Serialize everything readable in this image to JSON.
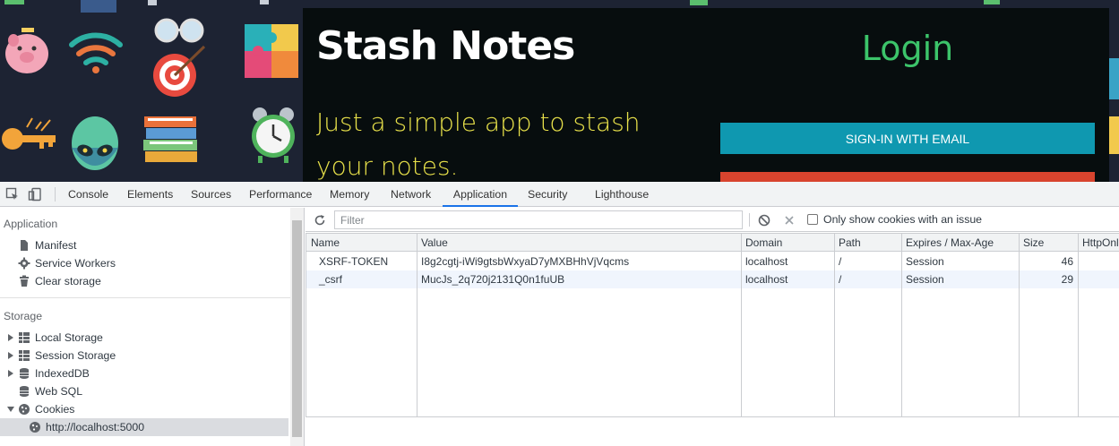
{
  "page": {
    "title": "Stash Notes",
    "tagline": "Just a simple app to stash your notes.",
    "login_heading": "Login",
    "signin_email_label": "SIGN-IN WITH EMAIL",
    "colors": {
      "card": "#070d0e",
      "title": "#ffffff",
      "tagline": "#e8e14a",
      "login": "#3cc46a",
      "email_button": "#0f98b0",
      "google_button": "#d8442e"
    },
    "background_icons": [
      "piggy-bank-icon",
      "wifi-icon",
      "glasses-icon",
      "target-icon",
      "puzzle-icon",
      "key-icon",
      "alien-icon",
      "books-icon",
      "alarm-clock-icon"
    ]
  },
  "devtools": {
    "tabs": [
      "Console",
      "Elements",
      "Sources",
      "Performance",
      "Memory",
      "Network",
      "Application",
      "Security",
      "Lighthouse"
    ],
    "active_tab": "Application",
    "sidebar": {
      "application_header": "Application",
      "application_items": [
        "Manifest",
        "Service Workers",
        "Clear storage"
      ],
      "storage_header": "Storage",
      "storage_items": [
        "Local Storage",
        "Session Storage",
        "IndexedDB",
        "Web SQL",
        "Cookies"
      ],
      "cookie_origin": "http://localhost:5000"
    },
    "toolbar": {
      "filter_placeholder": "Filter",
      "only_issues_label": "Only show cookies with an issue"
    },
    "table": {
      "columns": [
        "Name",
        "Value",
        "Domain",
        "Path",
        "Expires / Max-Age",
        "Size",
        "HttpOnl"
      ],
      "rows": [
        {
          "name": "XSRF-TOKEN",
          "value": "I8g2cgtj-iWi9gtsbWxyaD7yMXBHhVjVqcms",
          "domain": "localhost",
          "path": "/",
          "expires": "Session",
          "size": "46"
        },
        {
          "name": "_csrf",
          "value": "MucJs_2q720j2131Q0n1fuUB",
          "domain": "localhost",
          "path": "/",
          "expires": "Session",
          "size": "29"
        }
      ]
    }
  }
}
